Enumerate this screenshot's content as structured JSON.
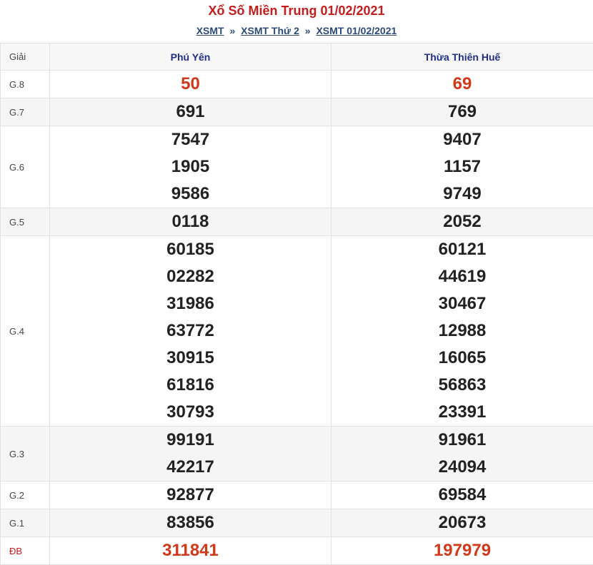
{
  "header": {
    "title": "Xổ Số Miền Trung 01/02/2021",
    "breadcrumb": [
      {
        "label": "XSMT"
      },
      {
        "label": "XSMT Thứ 2"
      },
      {
        "label": "XSMT 01/02/2021"
      }
    ],
    "separator": "»"
  },
  "table": {
    "col_label": "Giải",
    "provinces": [
      "Phú Yên",
      "Thừa Thiên Huế"
    ],
    "rows": {
      "g8": {
        "label": "G.8",
        "a": [
          "50"
        ],
        "b": [
          "69"
        ]
      },
      "g7": {
        "label": "G.7",
        "a": [
          "691"
        ],
        "b": [
          "769"
        ]
      },
      "g6": {
        "label": "G.6",
        "a": [
          "7547",
          "1905",
          "9586"
        ],
        "b": [
          "9407",
          "1157",
          "9749"
        ]
      },
      "g5": {
        "label": "G.5",
        "a": [
          "0118"
        ],
        "b": [
          "2052"
        ]
      },
      "g4": {
        "label": "G.4",
        "a": [
          "60185",
          "02282",
          "31986",
          "63772",
          "30915",
          "61816",
          "30793"
        ],
        "b": [
          "60121",
          "44619",
          "30467",
          "12988",
          "16065",
          "56863",
          "23391"
        ]
      },
      "g3": {
        "label": "G.3",
        "a": [
          "99191",
          "42217"
        ],
        "b": [
          "91961",
          "24094"
        ]
      },
      "g2": {
        "label": "G.2",
        "a": [
          "92877"
        ],
        "b": [
          "69584"
        ]
      },
      "g1": {
        "label": "G.1",
        "a": [
          "83856"
        ],
        "b": [
          "20673"
        ]
      },
      "db": {
        "label": "ĐB",
        "a": [
          "311841"
        ],
        "b": [
          "197979"
        ]
      }
    }
  },
  "colors": {
    "title": "#c51c1c",
    "link": "#2b4a78",
    "province": "#1f2e8a",
    "highlight_number": "#d2381a"
  }
}
